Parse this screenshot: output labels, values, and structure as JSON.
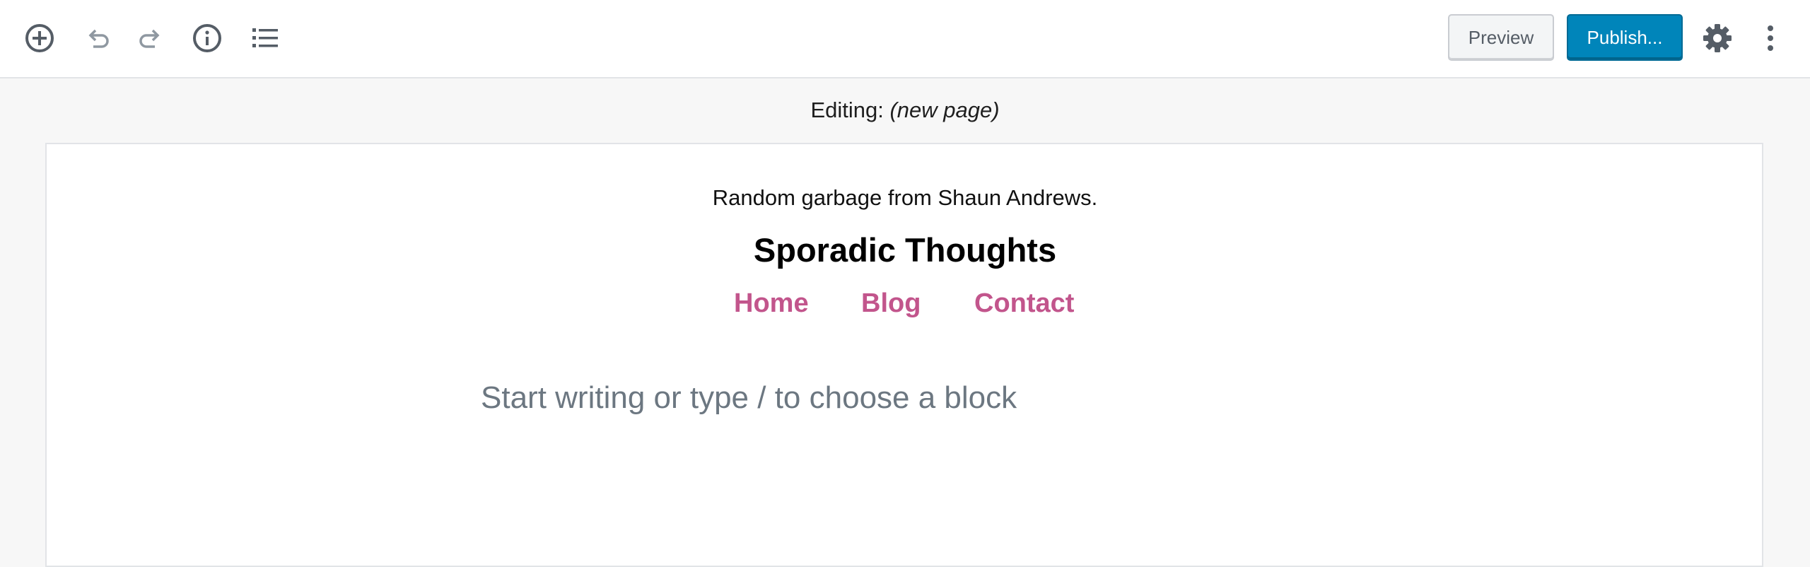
{
  "toolbar": {
    "icons": {
      "add": "plus-circle-icon",
      "undo": "undo-icon",
      "redo": "redo-icon",
      "info": "info-icon",
      "outline": "list-icon",
      "settings": "gear-icon",
      "more": "more-vertical-icon"
    },
    "preview_label": "Preview",
    "publish_label": "Publish..."
  },
  "editor": {
    "editing_prefix": "Editing:",
    "editing_title": "(new page)",
    "placeholder": "Start writing or type / to choose a block"
  },
  "site": {
    "tagline": "Random garbage from Shaun Andrews.",
    "title": "Sporadic Thoughts",
    "nav": [
      "Home",
      "Blog",
      "Contact"
    ]
  },
  "colors": {
    "accent": "#0085ba",
    "nav_link": "#c2558c",
    "background": "#f7f7f7"
  }
}
